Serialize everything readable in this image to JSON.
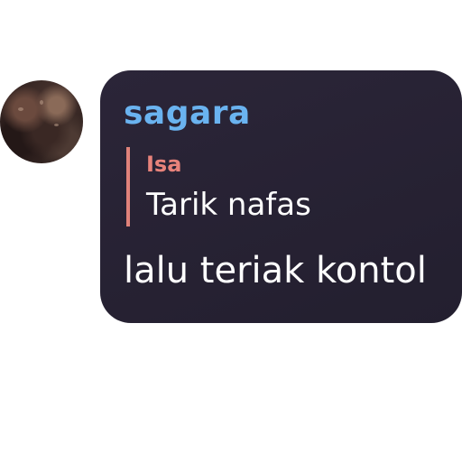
{
  "avatar": {
    "icon": "user-avatar-photo"
  },
  "message": {
    "sender": "sagara",
    "reply": {
      "name": "Isa",
      "text": "Tarik nafas"
    },
    "body": "lalu teriak kontol"
  },
  "colors": {
    "bubble_background": "#272234",
    "sender_name": "#6ab3f0",
    "reply_accent": "#e0827a",
    "text": "#ffffff"
  }
}
